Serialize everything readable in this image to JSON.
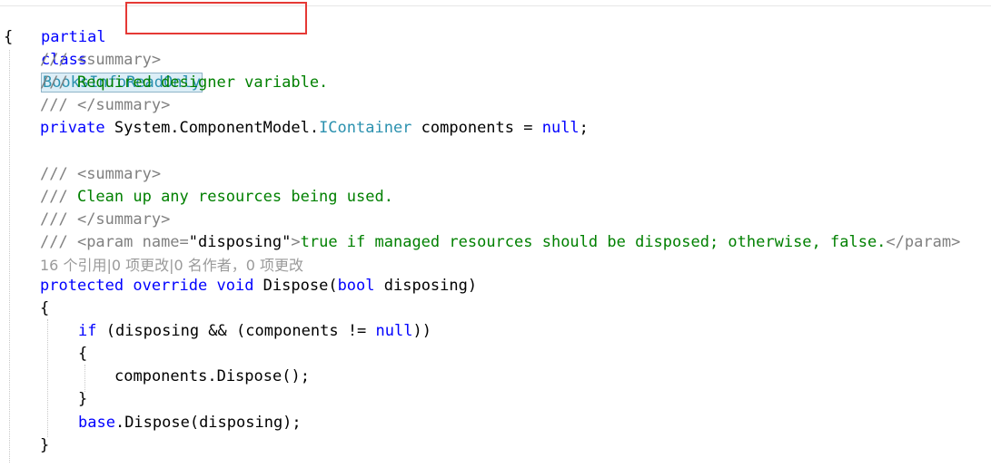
{
  "code": {
    "line1": {
      "kw1": "partial",
      "kw2": "class",
      "classname": "BooksInfoReadOnly"
    },
    "line2": {
      "text": "{"
    },
    "line3": {
      "prefix": "///",
      "text": " <summary>"
    },
    "line4": {
      "prefix": "///",
      "text": " Required designer variable."
    },
    "line5": {
      "prefix": "///",
      "text": " </summary>"
    },
    "line6": {
      "kw": "private",
      "ns": " System.ComponentModel.",
      "type": "IContainer",
      "rest": " components = ",
      "null": "null",
      "end": ";"
    },
    "line8": {
      "prefix": "///",
      "text": " <summary>"
    },
    "line9": {
      "prefix": "///",
      "text": " Clean up any resources being used."
    },
    "line10": {
      "prefix": "///",
      "text": " </summary>"
    },
    "line11": {
      "prefix": "///",
      "tag_open": " <param name=",
      "attr": "\"disposing\"",
      "tag_close": ">",
      "text": "true if managed resources should be disposed; otherwise, false.",
      "end_tag": "</param>"
    },
    "codelens": "16 个引用|0 项更改|0 名作者，0 项更改",
    "line12": {
      "kw1": "protected",
      "kw2": " override",
      "kw3": " void",
      "name": " Dispose(",
      "kw4": "bool",
      "rest": " disposing)"
    },
    "line13": {
      "text": "{"
    },
    "line14": {
      "kw": "if",
      "a": " (disposing && (components != ",
      "null": "null",
      "b": "))"
    },
    "line15": {
      "text": "{"
    },
    "line16": {
      "text": "components.Dispose();"
    },
    "line17": {
      "text": "}"
    },
    "line18": {
      "kw": "base",
      "rest": ".Dispose(disposing);"
    },
    "line19": {
      "text": "}"
    }
  },
  "colors": {
    "keyword": "#0000ff",
    "comment": "#008000",
    "doc_tag": "#808080",
    "type": "#2b91af",
    "highlight_box": "#e53935"
  }
}
